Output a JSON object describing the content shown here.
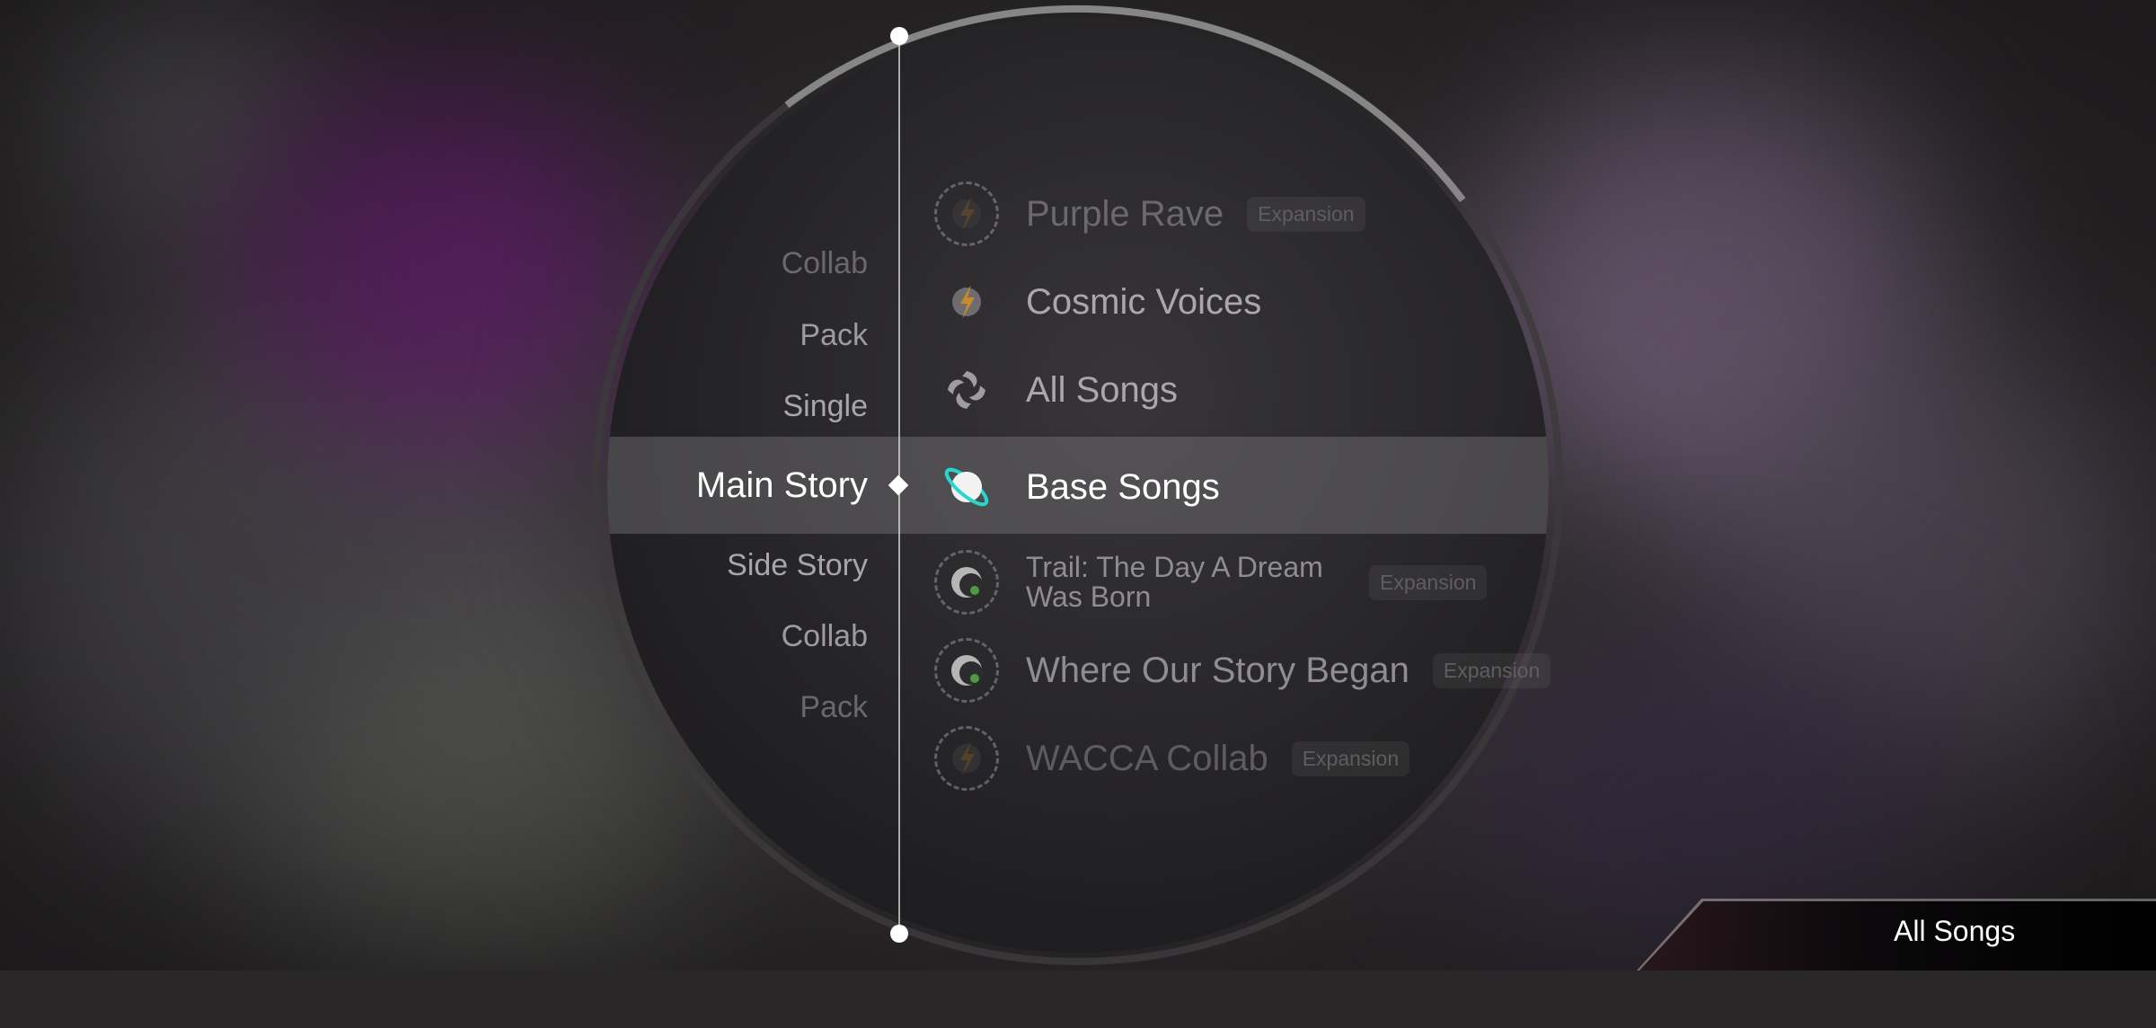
{
  "categories": [
    {
      "label": "Collab",
      "color": "#6a686b"
    },
    {
      "label": "Pack",
      "color": "#9d9b9e"
    },
    {
      "label": "Single",
      "color": "#a8a6a9"
    },
    {
      "label": "Main Story",
      "color": "#ffffff",
      "selected": true
    },
    {
      "label": "Side Story",
      "color": "#a8a6a9"
    },
    {
      "label": "Collab",
      "color": "#9d9b9e"
    },
    {
      "label": "Pack",
      "color": "#6a686b"
    }
  ],
  "songs": [
    {
      "title": "Purple Rave",
      "badge": "Expansion",
      "icon": "bolt-icon",
      "locked": true,
      "color": "#6b696c"
    },
    {
      "title": "Cosmic Voices",
      "badge": "",
      "icon": "bolt-icon",
      "locked": false,
      "color": "#a9a7aa"
    },
    {
      "title": "All Songs",
      "badge": "",
      "icon": "swirl-icon",
      "locked": false,
      "color": "#a9a7aa"
    },
    {
      "title": "Base Songs",
      "badge": "",
      "icon": "planet-icon",
      "locked": false,
      "selected": true,
      "color": "#ffffff"
    },
    {
      "title": "Trail: The Day A Dream Was Born",
      "badge": "Expansion",
      "icon": "crescent-icon",
      "locked": true,
      "color": "#8f8d90"
    },
    {
      "title": "Where Our Story Began",
      "badge": "Expansion",
      "icon": "crescent-icon",
      "locked": true,
      "color": "#8f8d90"
    },
    {
      "title": "WACCA Collab",
      "badge": "Expansion",
      "icon": "bolt-icon",
      "locked": true,
      "color": "#5e5c5f"
    }
  ],
  "tab": {
    "label": "All Songs"
  },
  "colors": {
    "accent_cyan": "#28d6d0",
    "bolt_orange": "#c9892c",
    "crescent_green": "#56b947"
  }
}
